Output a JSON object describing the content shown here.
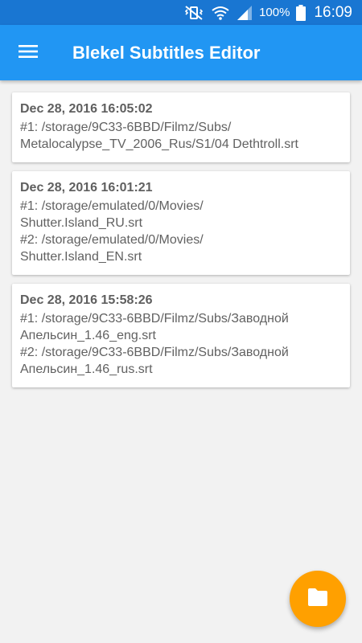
{
  "status_bar": {
    "battery_percent": "100%",
    "time": "16:09",
    "icons": [
      "vibrate-mute-icon",
      "wifi-icon",
      "signal-icon",
      "battery-icon"
    ]
  },
  "app_bar": {
    "title": "Blekel Subtitles Editor",
    "menu_icon": "hamburger-menu-icon",
    "color": "#2196f3"
  },
  "history": [
    {
      "date": "Dec 28, 2016 16:05:02",
      "files": [
        {
          "prefix": "#1: ",
          "line1": "/storage/9C33-6BBD/Filmz/Subs/",
          "line2": "Metalocalypse_TV_2006_Rus/S1/04 Dethtroll.srt"
        }
      ]
    },
    {
      "date": "Dec 28, 2016 16:01:21",
      "files": [
        {
          "prefix": "#1: ",
          "line1": "/storage/emulated/0/Movies/",
          "line2": "Shutter.Island_RU.srt"
        },
        {
          "prefix": "#2: ",
          "line1": "/storage/emulated/0/Movies/",
          "line2": "Shutter.Island_EN.srt"
        }
      ]
    },
    {
      "date": "Dec 28, 2016 15:58:26",
      "files": [
        {
          "prefix": "#1: ",
          "line1": "/storage/9C33-6BBD/Filmz/Subs/Заводной",
          "line2": "Апельсин_1.46_eng.srt"
        },
        {
          "prefix": "#2: ",
          "line1": "/storage/9C33-6BBD/Filmz/Subs/Заводной",
          "line2": "Апельсин_1.46_rus.srt"
        }
      ]
    }
  ],
  "fab": {
    "icon": "folder-icon",
    "color": "#ffa000"
  }
}
